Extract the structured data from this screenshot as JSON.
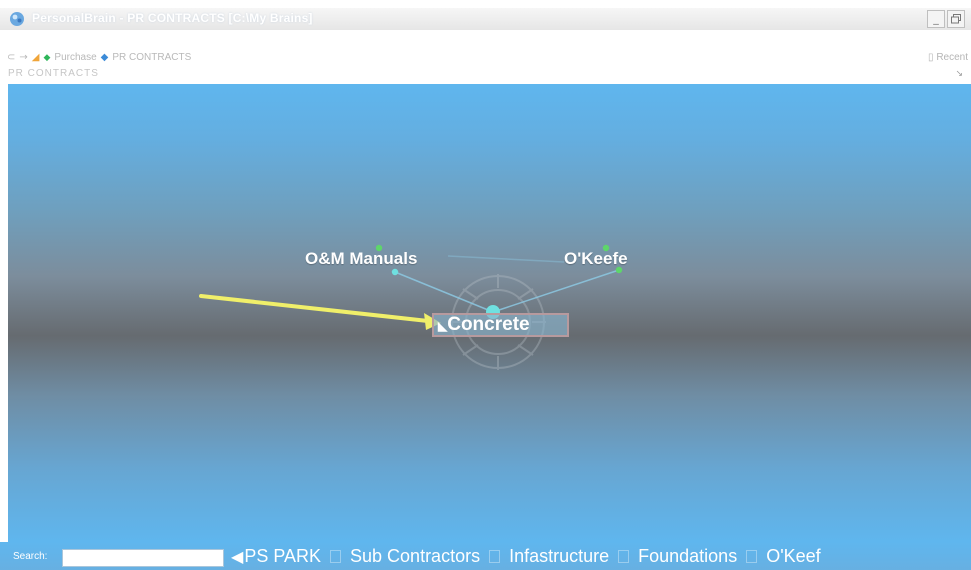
{
  "window": {
    "title": "PersonalBrain - PR CONTRACTS [C:\\My Brains]",
    "minimize_label": "_",
    "restore_label": " "
  },
  "toolbar": {
    "nav_items": [
      "Purchase",
      "PR CONTRACTS"
    ],
    "recent_label": "Recent",
    "plex_title": "PR CONTRACTS"
  },
  "plex": {
    "central_thought": "Concrete",
    "child_thoughts": [
      "O&M Manuals",
      "O'Keefe"
    ]
  },
  "bottombar": {
    "search_label": "Search:",
    "search_value": "",
    "pins": [
      "PS PARK",
      "Sub Contractors",
      "Infastructure",
      "Foundations",
      "O'Keef"
    ]
  },
  "colors": {
    "plex_top": "#5fb6ee",
    "plex_middle": "#666b70",
    "link_line": "#8cc8e2",
    "node_dot": "#6fe0e0",
    "node_dot_green": "#5ed66a",
    "annotation_arrow": "#f0ef6a"
  },
  "icons": [
    "brain-logo-icon",
    "back-icon",
    "forward-icon",
    "home-icon",
    "purchase-dot-icon",
    "plex-dot-icon",
    "recent-icon",
    "annotation-arrow"
  ]
}
